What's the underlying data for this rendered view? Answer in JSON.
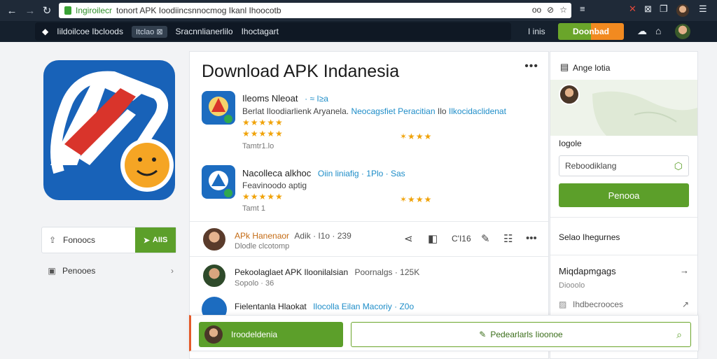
{
  "browser": {
    "address_text_1": "Ingiroilecr",
    "address_text_2": "tonort APK Ioodiincsnnocmog Ikanl Ihoocotb",
    "address_icons": [
      "oo",
      "☆"
    ],
    "extensions": [
      "≡",
      "✕",
      "⊠",
      "❐",
      "☰"
    ]
  },
  "second_bar": {
    "brand": "Iildoilcoe Ibcloods",
    "pill": "Itclao ⊠",
    "middle": "Sracnnlianerlilo",
    "right": "Ihoctagart",
    "tabs_label": "I inis",
    "download_label": "Doonbad"
  },
  "app_panel": {
    "title": "Download APK Indanesia",
    "items": [
      {
        "title": "Ileoms Nleoat",
        "title_meta": "· ≈ I≥a",
        "subtitle_dark": "Berlat Iloodiarlienk Aryanela.",
        "subtitle_blue": "Neocagsfiet Peracitian",
        "subtitle_dark2": "Ilo",
        "subtitle_blue2": "Ilkocidaclidenat",
        "rating_line_1": "★★★★★",
        "rating_line_2": "★★★★★",
        "right_stars": "✶★★★",
        "footer": "Tamtr1.lo"
      },
      {
        "title": "Nacolleca alkhoc",
        "title_meta": "Oiin liniafig · 1Plo · Sas",
        "subtitle_dark": "Feavinoodo aptig",
        "rating_line_1": "★★★★★",
        "right_stars": "✶★★★",
        "footer": "Tamt 1"
      }
    ],
    "comment": {
      "name": "APk Hanenaor",
      "meta": "Adik · I1o · 239",
      "sub": "Dlodle clcotomp",
      "count": "C'I16"
    },
    "list_rows": [
      {
        "title": "Pekoolaglaet APK Iloonilalsian",
        "meta": "Poornalgs · 125K",
        "sub": "Sopolo · 36"
      },
      {
        "title": "Fielentanla Hlaokat",
        "meta": "Ilocolla Eilan Macoriy · Z0o"
      }
    ]
  },
  "left": {
    "btn_label": "Fonoocs",
    "btn_green": "AIIS",
    "row_label": "Penooes"
  },
  "sidebar": {
    "header": "Ange lotia",
    "map_label": "Iogole",
    "input_placeholder": "Reboodiklang",
    "button": "Penooa",
    "section1": "Selao Ihegurnes",
    "section2": "Miqdapmgags",
    "section2_sub": "Diooolo",
    "section3": "Ihdbecrooces"
  },
  "bottom": {
    "green_label": "Iroodeldenia",
    "outline_label": "Pedearlarls Iioonoe"
  },
  "colors": {
    "accent_green": "#5c9f2a",
    "accent_blue": "#1e8dc8",
    "star_orange": "#f0a30a",
    "chrome_dark": "#1f2a38"
  }
}
